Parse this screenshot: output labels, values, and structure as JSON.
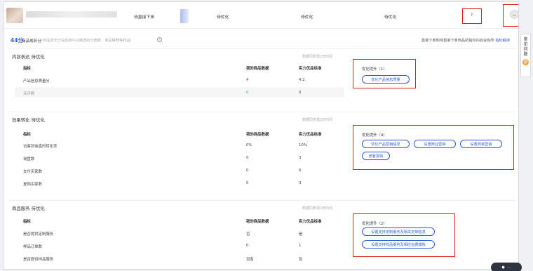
{
  "topbar": {
    "cells": [
      "待直接下单",
      "待优化",
      "待优化",
      "待优化"
    ],
    "question_mark": "?",
    "collapse_icon": "chevron-up-icon"
  },
  "score": {
    "value": "44分",
    "label": "商品成长分",
    "desc": "(商品成长分是后续平台精选的分值数，单品推荐等权益)",
    "right_tip": "直接下单和待直接下单商品的指标内容会有所",
    "right_link": "指标解读"
  },
  "sections": [
    {
      "title": "内容表达  待优化",
      "sync": "数据同步需2天时间",
      "headers": [
        "指标",
        "我的商品数据",
        "实力优品标准"
      ],
      "rows": [
        [
          "产品信息质量分",
          "4",
          "4.2"
        ],
        [
          "买评数",
          "0",
          "0"
        ]
      ],
      "opt_title": "优化提升（1）",
      "buttons": [
        "优化产品信息质量"
      ]
    },
    {
      "title": "效果转化  待优化",
      "sync": "数据同步需2天时间",
      "headers": [
        "指标",
        "我的商品数据",
        "实力优品标准"
      ],
      "rows": [
        [
          "访客到询盘的转化率",
          "0%",
          "10%"
        ],
        [
          "询盘数",
          "0",
          "3"
        ],
        [
          "支付买家数",
          "0",
          "6"
        ],
        [
          "复购买家数",
          "0",
          "3"
        ]
      ],
      "opt_title": "优化提升（4）",
      "buttons": [
        "优化产品营销信息",
        "设置商业营销",
        "设置商家营销",
        "老客复购"
      ]
    },
    {
      "title": "商品服务  待优化",
      "sync": "数据同步需2天时间",
      "headers": [
        "指标",
        "我的商品数据",
        "实力优品标准"
      ],
      "rows": [
        [
          "是否提供定制服务",
          "否",
          "是"
        ],
        [
          "样品订单数",
          "0",
          "1"
        ],
        [
          "是否提供样品服务",
          "没有",
          "有"
        ]
      ],
      "opt_title": "优化提升（2）",
      "buttons": [
        "设置支持定制服务及相关定制信息",
        "设置支持样品服务及相应运费模板"
      ]
    }
  ],
  "side_widget": [
    "常",
    "见",
    "问",
    "题"
  ]
}
